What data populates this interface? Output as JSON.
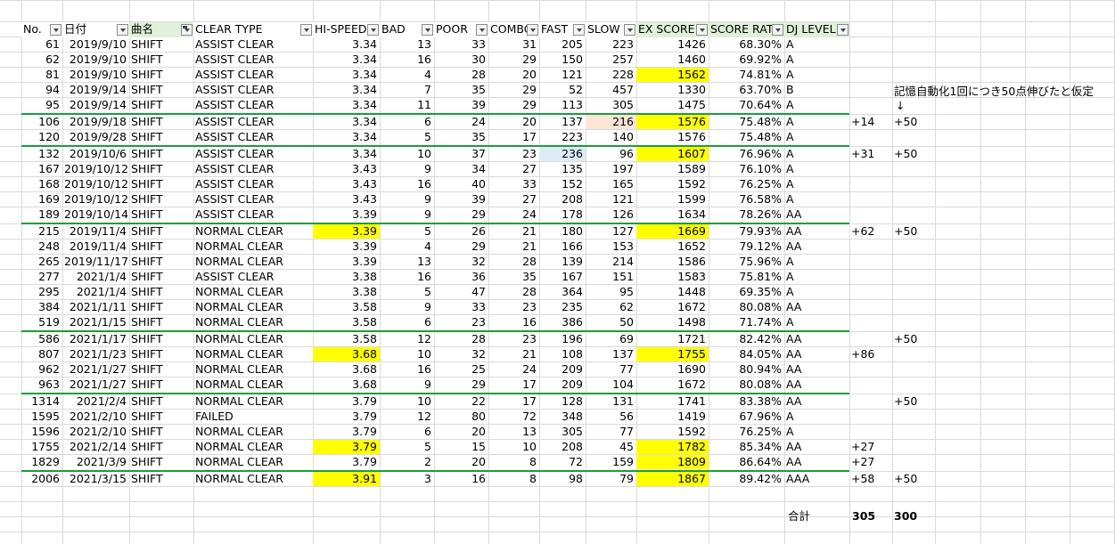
{
  "headers": [
    "No.",
    "日付",
    "曲名",
    "CLEAR TYPE",
    "HI-SPEED",
    "BAD",
    "POOR",
    "COMBO",
    "FAST",
    "SLOW",
    "EX SCORE",
    "SCORE RATE",
    "DJ LEVEL"
  ],
  "colors": {
    "highlight_yellow": "#ffff00",
    "highlight_orange": "#fce4d6",
    "highlight_blue": "#ddebf7",
    "separator_green": "#1a9e3a",
    "header_green": "#e2efda"
  },
  "rows": [
    {
      "no": "61",
      "date": "2019/9/10",
      "song": "SHIFT",
      "clear": "ASSIST CLEAR",
      "hs": "3.34",
      "bad": "13",
      "poor": "33",
      "combo": "31",
      "fast": "205",
      "slow": "223",
      "ex": "1426",
      "rate": "68.30%",
      "dj": "A",
      "diff": "",
      "bonus": ""
    },
    {
      "no": "62",
      "date": "2019/9/10",
      "song": "SHIFT",
      "clear": "ASSIST CLEAR",
      "hs": "3.34",
      "bad": "16",
      "poor": "30",
      "combo": "29",
      "fast": "150",
      "slow": "257",
      "ex": "1460",
      "rate": "69.92%",
      "dj": "A",
      "diff": "",
      "bonus": ""
    },
    {
      "no": "81",
      "date": "2019/9/10",
      "song": "SHIFT",
      "clear": "ASSIST CLEAR",
      "hs": "3.34",
      "bad": "4",
      "poor": "28",
      "combo": "20",
      "fast": "121",
      "slow": "228",
      "ex": "1562",
      "rate": "74.81%",
      "dj": "A",
      "diff": "",
      "bonus": "",
      "hl": {
        "ex": "y"
      }
    },
    {
      "no": "94",
      "date": "2019/9/14",
      "song": "SHIFT",
      "clear": "ASSIST CLEAR",
      "hs": "3.34",
      "bad": "7",
      "poor": "35",
      "combo": "29",
      "fast": "52",
      "slow": "457",
      "ex": "1330",
      "rate": "63.70%",
      "dj": "B",
      "diff": "",
      "bonus": ""
    },
    {
      "no": "95",
      "date": "2019/9/14",
      "song": "SHIFT",
      "clear": "ASSIST CLEAR",
      "hs": "3.34",
      "bad": "11",
      "poor": "39",
      "combo": "29",
      "fast": "113",
      "slow": "305",
      "ex": "1475",
      "rate": "70.64%",
      "dj": "A",
      "diff": "",
      "bonus": ""
    },
    {
      "no": "106",
      "date": "2019/9/18",
      "song": "SHIFT",
      "clear": "ASSIST CLEAR",
      "hs": "3.34",
      "bad": "6",
      "poor": "24",
      "combo": "20",
      "fast": "137",
      "slow": "216",
      "ex": "1576",
      "rate": "75.48%",
      "dj": "A",
      "diff": "+14",
      "bonus": "+50",
      "hl": {
        "slow": "o",
        "ex": "y"
      }
    },
    {
      "no": "120",
      "date": "2019/9/28",
      "song": "SHIFT",
      "clear": "ASSIST CLEAR",
      "hs": "3.34",
      "bad": "5",
      "poor": "35",
      "combo": "17",
      "fast": "223",
      "slow": "140",
      "ex": "1576",
      "rate": "75.48%",
      "dj": "A",
      "diff": "",
      "bonus": ""
    },
    {
      "no": "132",
      "date": "2019/10/6",
      "song": "SHIFT",
      "clear": "ASSIST CLEAR",
      "hs": "3.34",
      "bad": "10",
      "poor": "37",
      "combo": "23",
      "fast": "236",
      "slow": "96",
      "ex": "1607",
      "rate": "76.96%",
      "dj": "A",
      "diff": "+31",
      "bonus": "+50",
      "hl": {
        "fast": "b",
        "ex": "y"
      }
    },
    {
      "no": "167",
      "date": "2019/10/12",
      "song": "SHIFT",
      "clear": "ASSIST CLEAR",
      "hs": "3.43",
      "bad": "9",
      "poor": "34",
      "combo": "27",
      "fast": "135",
      "slow": "197",
      "ex": "1589",
      "rate": "76.10%",
      "dj": "A",
      "diff": "",
      "bonus": ""
    },
    {
      "no": "168",
      "date": "2019/10/12",
      "song": "SHIFT",
      "clear": "ASSIST CLEAR",
      "hs": "3.43",
      "bad": "16",
      "poor": "40",
      "combo": "33",
      "fast": "152",
      "slow": "165",
      "ex": "1592",
      "rate": "76.25%",
      "dj": "A",
      "diff": "",
      "bonus": ""
    },
    {
      "no": "169",
      "date": "2019/10/12",
      "song": "SHIFT",
      "clear": "ASSIST CLEAR",
      "hs": "3.43",
      "bad": "9",
      "poor": "39",
      "combo": "27",
      "fast": "208",
      "slow": "121",
      "ex": "1599",
      "rate": "76.58%",
      "dj": "A",
      "diff": "",
      "bonus": ""
    },
    {
      "no": "189",
      "date": "2019/10/14",
      "song": "SHIFT",
      "clear": "ASSIST CLEAR",
      "hs": "3.39",
      "bad": "9",
      "poor": "29",
      "combo": "24",
      "fast": "178",
      "slow": "126",
      "ex": "1634",
      "rate": "78.26%",
      "dj": "AA",
      "diff": "",
      "bonus": ""
    },
    {
      "no": "215",
      "date": "2019/11/4",
      "song": "SHIFT",
      "clear": "NORMAL CLEAR",
      "hs": "3.39",
      "bad": "5",
      "poor": "26",
      "combo": "21",
      "fast": "180",
      "slow": "127",
      "ex": "1669",
      "rate": "79.93%",
      "dj": "AA",
      "diff": "+62",
      "bonus": "+50",
      "hl": {
        "hs": "y",
        "ex": "y"
      }
    },
    {
      "no": "248",
      "date": "2019/11/4",
      "song": "SHIFT",
      "clear": "NORMAL CLEAR",
      "hs": "3.39",
      "bad": "4",
      "poor": "29",
      "combo": "21",
      "fast": "166",
      "slow": "153",
      "ex": "1652",
      "rate": "79.12%",
      "dj": "AA",
      "diff": "",
      "bonus": ""
    },
    {
      "no": "265",
      "date": "2019/11/17",
      "song": "SHIFT",
      "clear": "NORMAL CLEAR",
      "hs": "3.39",
      "bad": "13",
      "poor": "32",
      "combo": "28",
      "fast": "139",
      "slow": "214",
      "ex": "1586",
      "rate": "75.96%",
      "dj": "A",
      "diff": "",
      "bonus": ""
    },
    {
      "no": "277",
      "date": "2021/1/4",
      "song": "SHIFT",
      "clear": "ASSIST CLEAR",
      "hs": "3.38",
      "bad": "16",
      "poor": "36",
      "combo": "35",
      "fast": "167",
      "slow": "151",
      "ex": "1583",
      "rate": "75.81%",
      "dj": "A",
      "diff": "",
      "bonus": ""
    },
    {
      "no": "295",
      "date": "2021/1/4",
      "song": "SHIFT",
      "clear": "NORMAL CLEAR",
      "hs": "3.38",
      "bad": "5",
      "poor": "47",
      "combo": "28",
      "fast": "364",
      "slow": "95",
      "ex": "1448",
      "rate": "69.35%",
      "dj": "A",
      "diff": "",
      "bonus": ""
    },
    {
      "no": "384",
      "date": "2021/1/11",
      "song": "SHIFT",
      "clear": "NORMAL CLEAR",
      "hs": "3.58",
      "bad": "9",
      "poor": "33",
      "combo": "23",
      "fast": "235",
      "slow": "62",
      "ex": "1672",
      "rate": "80.08%",
      "dj": "AA",
      "diff": "",
      "bonus": ""
    },
    {
      "no": "519",
      "date": "2021/1/15",
      "song": "SHIFT",
      "clear": "NORMAL CLEAR",
      "hs": "3.58",
      "bad": "6",
      "poor": "23",
      "combo": "16",
      "fast": "386",
      "slow": "50",
      "ex": "1498",
      "rate": "71.74%",
      "dj": "A",
      "diff": "",
      "bonus": ""
    },
    {
      "no": "586",
      "date": "2021/1/17",
      "song": "SHIFT",
      "clear": "NORMAL CLEAR",
      "hs": "3.58",
      "bad": "12",
      "poor": "28",
      "combo": "23",
      "fast": "196",
      "slow": "69",
      "ex": "1721",
      "rate": "82.42%",
      "dj": "AA",
      "diff": "",
      "bonus": "+50"
    },
    {
      "no": "807",
      "date": "2021/1/23",
      "song": "SHIFT",
      "clear": "NORMAL CLEAR",
      "hs": "3.68",
      "bad": "10",
      "poor": "32",
      "combo": "21",
      "fast": "108",
      "slow": "137",
      "ex": "1755",
      "rate": "84.05%",
      "dj": "AA",
      "diff": "+86",
      "bonus": "",
      "hl": {
        "hs": "y",
        "ex": "y"
      }
    },
    {
      "no": "962",
      "date": "2021/1/27",
      "song": "SHIFT",
      "clear": "NORMAL CLEAR",
      "hs": "3.68",
      "bad": "16",
      "poor": "25",
      "combo": "24",
      "fast": "209",
      "slow": "77",
      "ex": "1690",
      "rate": "80.94%",
      "dj": "AA",
      "diff": "",
      "bonus": ""
    },
    {
      "no": "963",
      "date": "2021/1/27",
      "song": "SHIFT",
      "clear": "NORMAL CLEAR",
      "hs": "3.68",
      "bad": "9",
      "poor": "29",
      "combo": "17",
      "fast": "209",
      "slow": "104",
      "ex": "1672",
      "rate": "80.08%",
      "dj": "AA",
      "diff": "",
      "bonus": ""
    },
    {
      "no": "1314",
      "date": "2021/2/4",
      "song": "SHIFT",
      "clear": "NORMAL CLEAR",
      "hs": "3.79",
      "bad": "10",
      "poor": "22",
      "combo": "17",
      "fast": "128",
      "slow": "131",
      "ex": "1741",
      "rate": "83.38%",
      "dj": "AA",
      "diff": "",
      "bonus": "+50"
    },
    {
      "no": "1595",
      "date": "2021/2/10",
      "song": "SHIFT",
      "clear": "FAILED",
      "hs": "3.79",
      "bad": "12",
      "poor": "80",
      "combo": "72",
      "fast": "348",
      "slow": "56",
      "ex": "1419",
      "rate": "67.96%",
      "dj": "A",
      "diff": "",
      "bonus": ""
    },
    {
      "no": "1596",
      "date": "2021/2/10",
      "song": "SHIFT",
      "clear": "NORMAL CLEAR",
      "hs": "3.79",
      "bad": "6",
      "poor": "20",
      "combo": "13",
      "fast": "305",
      "slow": "77",
      "ex": "1592",
      "rate": "76.25%",
      "dj": "A",
      "diff": "",
      "bonus": ""
    },
    {
      "no": "1755",
      "date": "2021/2/14",
      "song": "SHIFT",
      "clear": "NORMAL CLEAR",
      "hs": "3.79",
      "bad": "5",
      "poor": "15",
      "combo": "10",
      "fast": "208",
      "slow": "45",
      "ex": "1782",
      "rate": "85.34%",
      "dj": "AA",
      "diff": "+27",
      "bonus": "",
      "hl": {
        "hs": "y",
        "ex": "y"
      }
    },
    {
      "no": "1829",
      "date": "2021/3/9",
      "song": "SHIFT",
      "clear": "NORMAL CLEAR",
      "hs": "3.79",
      "bad": "2",
      "poor": "20",
      "combo": "8",
      "fast": "72",
      "slow": "159",
      "ex": "1809",
      "rate": "86.64%",
      "dj": "AA",
      "diff": "+27",
      "bonus": "",
      "hl": {
        "ex": "y"
      }
    },
    {
      "no": "2006",
      "date": "2021/3/15",
      "song": "SHIFT",
      "clear": "NORMAL CLEAR",
      "hs": "3.91",
      "bad": "3",
      "poor": "16",
      "combo": "8",
      "fast": "98",
      "slow": "79",
      "ex": "1867",
      "rate": "89.42%",
      "dj": "AAA",
      "diff": "+58",
      "bonus": "+50",
      "hl": {
        "hs": "y",
        "ex": "y"
      }
    }
  ],
  "note": {
    "text": "記憶自動化1回につき50点伸びたと仮定",
    "arrow": "↓"
  },
  "totals": {
    "label": "合計",
    "diff_total": "305",
    "bonus_total": "300"
  }
}
